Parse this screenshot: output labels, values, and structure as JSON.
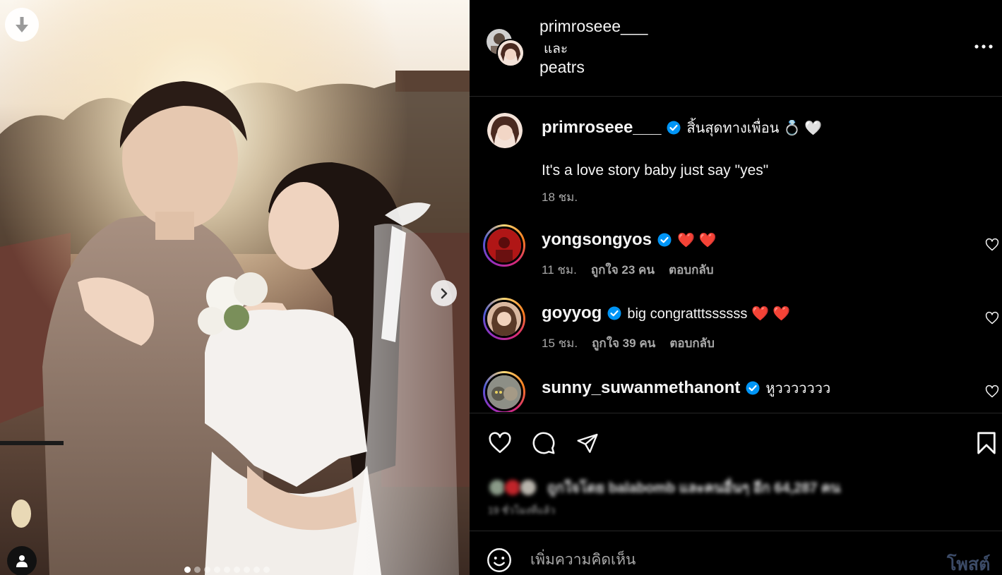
{
  "post": {
    "owners": [
      "primroseee___",
      "peatrs"
    ],
    "and_word": "และ",
    "more_icon": "more-horizontal-icon"
  },
  "media": {
    "download_icon": "download-arrow-icon",
    "next_icon": "chevron-right-icon",
    "tag_icon": "user-tag-icon",
    "carousel_count": 9,
    "carousel_index": 1
  },
  "caption": {
    "username": "primroseee___",
    "verified": true,
    "text": "สิ้นสุดทางเพื่อน 💍 🤍",
    "body": "It's a love story baby just say \"yes\"",
    "time": "18 ชม."
  },
  "comments": [
    {
      "username": "yongsongyos",
      "verified": true,
      "text": "❤️ ❤️",
      "time": "11 ชม.",
      "likes": "ถูกใจ 23 คน",
      "reply": "ตอบกลับ"
    },
    {
      "username": "goyyog",
      "verified": true,
      "text": "big congratttssssss ❤️ ❤️",
      "time": "15 ชม.",
      "likes": "ถูกใจ 39 คน",
      "reply": "ตอบกลับ"
    },
    {
      "username": "sunny_suwanmethanont",
      "verified": true,
      "text": "หูววววววว",
      "time": "",
      "likes": "",
      "reply": ""
    }
  ],
  "actions": {
    "like_icon": "heart-outline-icon",
    "comment_icon": "speech-bubble-icon",
    "share_icon": "paper-plane-icon",
    "save_icon": "bookmark-icon",
    "likes_text": "ถูกใจโดย balabomb และคนอื่นๆ อีก 64,287 คน",
    "time_text": "19 ชั่วโมงที่แล้ว"
  },
  "composer": {
    "emoji_icon": "emoji-smile-icon",
    "placeholder": "เพิ่มความคิดเห็น",
    "post_label": "โพสต์"
  },
  "colors": {
    "background": "#000000",
    "text": "#f5f5f5",
    "muted": "#a8a8a8",
    "verified": "#0095f6",
    "heart": "#ff3040",
    "post_disabled": "#3b4a66"
  }
}
